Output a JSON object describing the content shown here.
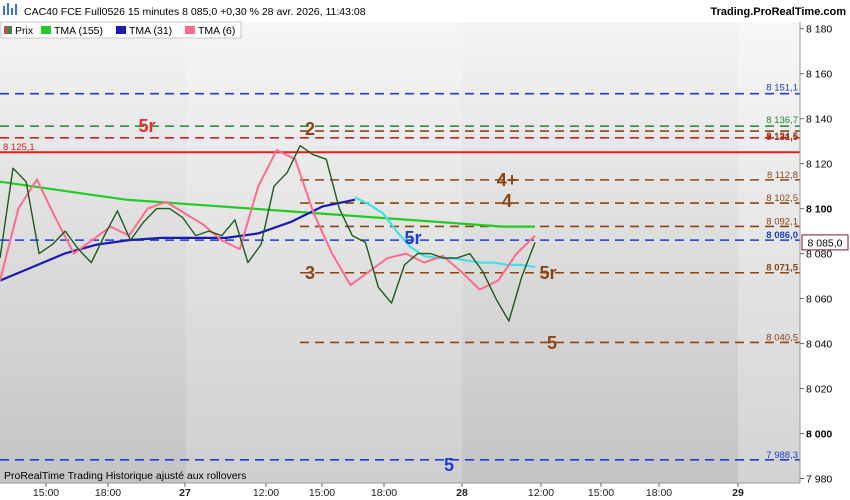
{
  "header": {
    "title": "CAC40 FCE Full0526 15 minutes 8 085,0 +0,30 % 28 avr. 2026, 11:43:08",
    "brand": "Trading.ProRealTime.com"
  },
  "legend": [
    {
      "label": "Prix",
      "color": "#c0504d",
      "icon": "candle-icon"
    },
    {
      "label": "TMA (155)",
      "color": "#22cc22",
      "icon": "color-swatch-icon"
    },
    {
      "label": "TMA (31)",
      "color": "#1a1ab0",
      "icon": "color-swatch-icon"
    },
    {
      "label": "TMA (6)",
      "color": "#ff6b8a",
      "icon": "color-swatch-icon"
    }
  ],
  "footer": "ProRealTime Trading  Historique ajusté aux rollovers",
  "chart_data": {
    "type": "line",
    "ylim": [
      7978,
      8183
    ],
    "y_ticks": [
      {
        "value": 7980,
        "label": "7 980"
      },
      {
        "value": 8000,
        "label": "8 000",
        "bold": true
      },
      {
        "value": 8020,
        "label": "8 020"
      },
      {
        "value": 8040,
        "label": "8 040"
      },
      {
        "value": 8060,
        "label": "8 060"
      },
      {
        "value": 8080,
        "label": "8 080"
      },
      {
        "value": 8100,
        "label": "8 100",
        "bold": true
      },
      {
        "value": 8120,
        "label": "8 120"
      },
      {
        "value": 8140,
        "label": "8 140"
      },
      {
        "value": 8160,
        "label": "8 160"
      },
      {
        "value": 8180,
        "label": "8 180"
      }
    ],
    "x_ticks": [
      {
        "label": "15:00",
        "bold": false
      },
      {
        "label": "18:00",
        "bold": false
      },
      {
        "label": "27",
        "bold": true
      },
      {
        "label": "12:00",
        "bold": false
      },
      {
        "label": "15:00",
        "bold": false
      },
      {
        "label": "18:00",
        "bold": false
      },
      {
        "label": "28",
        "bold": true
      },
      {
        "label": "12:00",
        "bold": false
      },
      {
        "label": "15:00",
        "bold": false
      },
      {
        "label": "18:00",
        "bold": false
      },
      {
        "label": "29",
        "bold": true
      }
    ],
    "current_price": {
      "value": 8085.0,
      "label": "8 085,0",
      "color": "#7a1a2a"
    },
    "horizontal_levels": [
      {
        "value": 8151.1,
        "label": "8 151,1",
        "color": "#1a3cd8",
        "style": "dashed",
        "full_width": true
      },
      {
        "value": 8136.7,
        "label": "8 136,7",
        "color": "#1a8a2a",
        "style": "dashed",
        "full_width": true
      },
      {
        "value": 8131.5,
        "label": "8 131,5",
        "color": "#cc2222",
        "style": "dashed",
        "full_width": true
      },
      {
        "value": 8134.5,
        "label": "8 134,5",
        "color": "#8b4513",
        "style": "dashed",
        "full_width": false
      },
      {
        "value": 8125.1,
        "label": "8 125,1",
        "color": "#e02020",
        "style": "solid",
        "full_width": true
      },
      {
        "value": 8112.8,
        "label": "8 112,8",
        "color": "#8b4513",
        "style": "dashed",
        "full_width": false
      },
      {
        "value": 8102.5,
        "label": "8 102,5",
        "color": "#8b4513",
        "style": "dashed",
        "full_width": false
      },
      {
        "value": 8092.1,
        "label": "8 092,1",
        "color": "#8b4513",
        "style": "dashed",
        "full_width": false
      },
      {
        "value": 8086.0,
        "label": "8 086,0",
        "color": "#1a3cd8",
        "style": "dashed",
        "full_width": true
      },
      {
        "value": 8071.5,
        "label": "8 071,5",
        "color": "#8b4513",
        "style": "dashed",
        "full_width": false
      },
      {
        "value": 8040.5,
        "label": "8 040,5",
        "color": "#8b4513",
        "style": "dashed",
        "full_width": false
      },
      {
        "value": 7988.3,
        "label": "7 988,3",
        "color": "#1a3cd8",
        "style": "dashed",
        "full_width": true
      }
    ],
    "annotations": [
      {
        "text": "5r",
        "color": "#e03030"
      },
      {
        "text": "2",
        "color": "#8b4513"
      },
      {
        "text": "4+",
        "color": "#8b4513"
      },
      {
        "text": "4",
        "color": "#8b4513"
      },
      {
        "text": "5r",
        "color": "#1a3cd8"
      },
      {
        "text": "3",
        "color": "#8b4513"
      },
      {
        "text": "5r",
        "color": "#8b4513"
      },
      {
        "text": "5",
        "color": "#8b4513"
      },
      {
        "text": "5",
        "color": "#1a3cd8"
      }
    ],
    "series": [
      {
        "name": "TMA (155)",
        "color": "#22cc22",
        "values": [
          8112,
          8110,
          8108,
          8106,
          8104,
          8103,
          8102,
          8101,
          8100,
          8099,
          8098,
          8097,
          8096,
          8095,
          8094,
          8093,
          8092,
          8092
        ]
      },
      {
        "name": "TMA (31)",
        "color": "#1a1ab0",
        "values": [
          8068,
          8074,
          8080,
          8084,
          8086,
          8087,
          8087,
          8087,
          8089,
          8094,
          8101,
          8104
        ]
      },
      {
        "name": "TMA (31) cont.",
        "color": "#40e0e8",
        "values": [
          8105,
          8102,
          8098,
          8090,
          8083,
          8079,
          8078,
          8078,
          8077,
          8076,
          8076,
          8075,
          8075,
          8074
        ]
      },
      {
        "name": "TMA (6)",
        "color": "#ff6b8a",
        "values": [
          8068,
          8100,
          8113,
          8096,
          8080,
          8086,
          8092,
          8088,
          8100,
          8103,
          8098,
          8093,
          8086,
          8082,
          8110,
          8126,
          8122,
          8098,
          8080,
          8066,
          8072,
          8078,
          8080,
          8076,
          8079,
          8072,
          8064,
          8068,
          8080,
          8088
        ]
      },
      {
        "name": "Prix",
        "color": "#1a5c1a",
        "values": [
          8078,
          8118,
          8112,
          8080,
          8084,
          8090,
          8082,
          8076,
          8088,
          8099,
          8086,
          8094,
          8100,
          8100,
          8096,
          8088,
          8090,
          8088,
          8095,
          8076,
          8084,
          8110,
          8116,
          8128,
          8124,
          8122,
          8100,
          8088,
          8085,
          8065,
          8058,
          8075,
          8080,
          8080,
          8078,
          8078,
          8080,
          8072,
          8060,
          8050,
          8070,
          8085
        ]
      }
    ]
  }
}
